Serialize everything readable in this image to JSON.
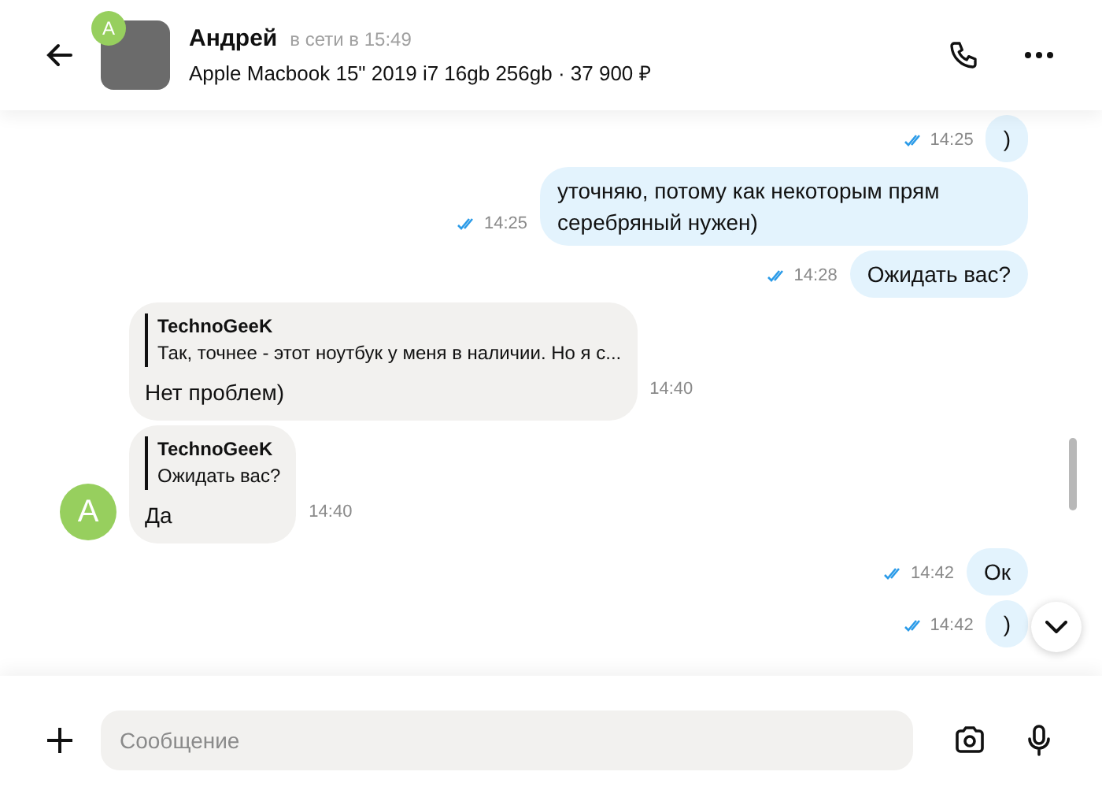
{
  "header": {
    "name": "Андрей",
    "status": "в сети в 15:49",
    "avatar_letter": "А",
    "listing": "Apple Macbook 15\" 2019 i7 16gb 256gb · 37 900 ₽"
  },
  "messages": [
    {
      "kind": "out",
      "text": ")",
      "time": "14:25",
      "read": true
    },
    {
      "kind": "out",
      "text": "уточняю, потому как некоторым прям серебряный нужен)",
      "time": "14:25",
      "read": true
    },
    {
      "kind": "out",
      "text": "Ожидать вас?",
      "time": "14:28",
      "read": true
    },
    {
      "kind": "in",
      "reply_author": "TechnoGeeK",
      "reply_text": "Так, точнее - этот ноутбук у меня в наличии. Но я с...",
      "text": "Нет проблем)",
      "time": "14:40",
      "avatar": false
    },
    {
      "kind": "in",
      "reply_author": "TechnoGeeK",
      "reply_text": "Ожидать вас?",
      "text": "Да",
      "time": "14:40",
      "avatar": true,
      "avatar_letter": "А"
    },
    {
      "kind": "out",
      "text": "Ок",
      "time": "14:42",
      "read": true
    },
    {
      "kind": "out",
      "text": ")",
      "time": "14:42",
      "read": true
    }
  ],
  "composer": {
    "placeholder": "Сообщение"
  }
}
